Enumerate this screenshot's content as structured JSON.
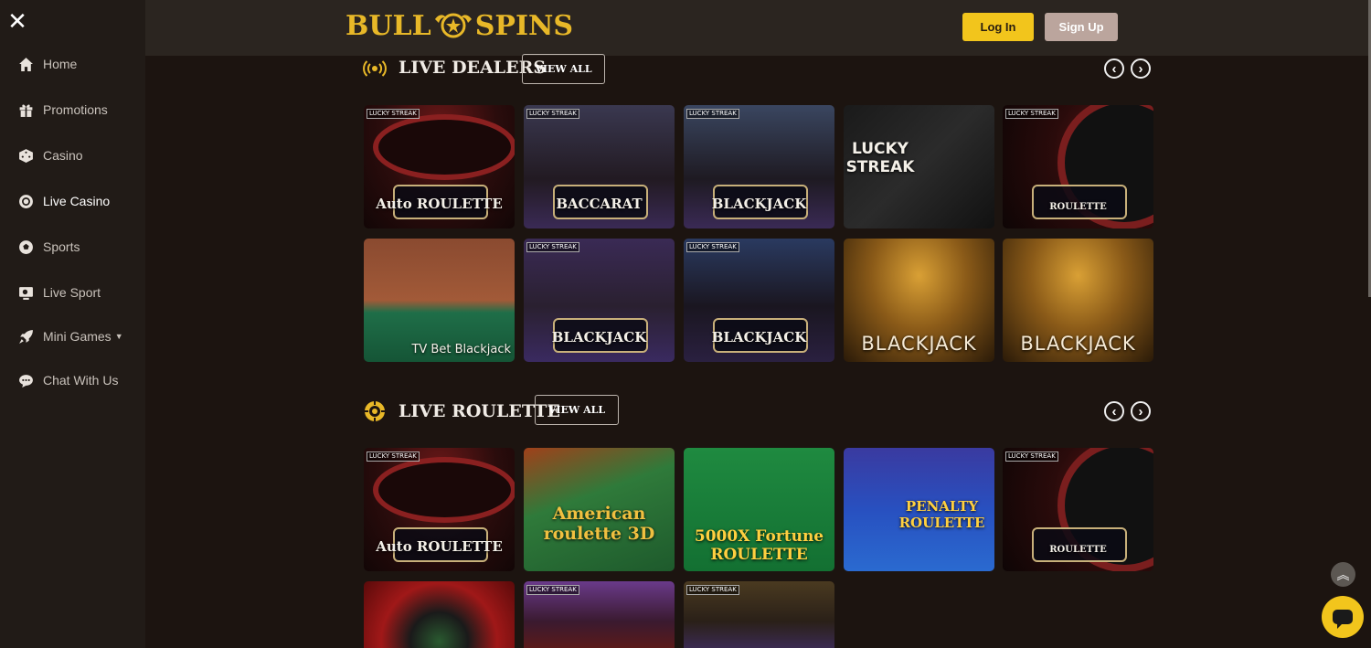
{
  "sidebar": {
    "close_icon": "close-icon",
    "items": [
      {
        "label": "Home",
        "icon": "home-icon"
      },
      {
        "label": "Promotions",
        "icon": "gift-icon"
      },
      {
        "label": "Casino",
        "icon": "dice-icon"
      },
      {
        "label": "Live Casino",
        "icon": "live-chip-icon",
        "active": true
      },
      {
        "label": "Sports",
        "icon": "soccer-ball-icon"
      },
      {
        "label": "Live Sport",
        "icon": "live-sport-icon"
      },
      {
        "label": "Mini Games",
        "icon": "rocket-icon",
        "has_caret": true
      },
      {
        "label": "Chat With Us",
        "icon": "chat-icon"
      }
    ]
  },
  "header": {
    "logo_left": "BULL",
    "logo_right": "SPINS",
    "login_label": "Log In",
    "signup_label": "Sign Up"
  },
  "sections": [
    {
      "title": "LIVE DEALERS",
      "icon": "broadcast-icon",
      "view_all_label": "VIEW ALL",
      "tiles": [
        {
          "label": "Auto ROULETTE",
          "badge": "LUCKY STREAK"
        },
        {
          "label": "BACCARAT",
          "badge": "LUCKY STREAK"
        },
        {
          "label": "BLACKJACK",
          "badge": "LUCKY STREAK"
        },
        {
          "label": "LUCKY STREAK",
          "badge": ""
        },
        {
          "label": "ROULETTE",
          "badge": "LUCKY STREAK"
        },
        {
          "label": "TV Bet Blackjack",
          "badge": ""
        },
        {
          "label": "BLACKJACK",
          "badge": "LUCKY STREAK"
        },
        {
          "label": "BLACKJACK",
          "badge": "LUCKY STREAK"
        },
        {
          "label": "BLACKJACK",
          "badge": ""
        },
        {
          "label": "BLACKJACK",
          "badge": ""
        }
      ]
    },
    {
      "title": "LIVE ROULETTE",
      "icon": "roulette-chip-icon",
      "view_all_label": "VIEW ALL",
      "tiles": [
        {
          "label": "Auto ROULETTE",
          "badge": "LUCKY STREAK"
        },
        {
          "label": "American roulette 3D",
          "badge": ""
        },
        {
          "label": "5000X Fortune ROULETTE",
          "badge": ""
        },
        {
          "label": "PENALTY ROULETTE",
          "badge": ""
        },
        {
          "label": "ROULETTE",
          "badge": "LUCKY STREAK"
        },
        {
          "label": "",
          "badge": ""
        },
        {
          "label": "",
          "badge": "LUCKY STREAK"
        },
        {
          "label": "",
          "badge": "LUCKY STREAK"
        }
      ]
    }
  ],
  "colors": {
    "accent_yellow": "#f2c51c",
    "signup_bg": "#bba59d",
    "page_bg": "#1c1410",
    "sidebar_bg": "#211b17"
  }
}
